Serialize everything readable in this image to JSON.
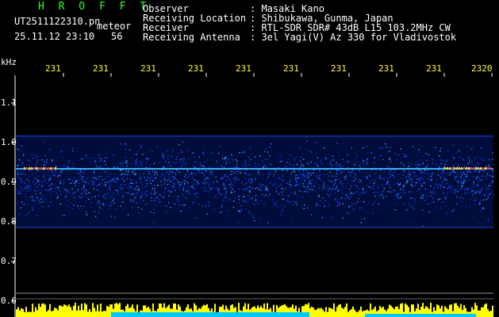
{
  "header": {
    "app_title": "H R O F F T",
    "filename": "UT2511122310.pn",
    "filename_suffix": "meteor",
    "datetime": "25.11.12 23:10",
    "seconds": "56",
    "info_labels": [
      "Observer",
      "Receiving Location",
      "Receiver",
      "Receiving Antenna"
    ],
    "info_values": [
      ": Masaki Kano",
      ": Shibukawa, Gunma, Japan",
      ": RTL-SDR SDR# 43dB L15 103.2MHz CW",
      ": 3el Yagi(V) Az 330 for Vladivostok"
    ]
  },
  "axis": {
    "unit_label": "kHz",
    "y_ticks": [
      "1.1",
      "1.0",
      "0.9",
      "0.8",
      "0.7",
      "0.6"
    ],
    "time_labels": [
      "231",
      "231",
      "231",
      "231",
      "231",
      "231",
      "231",
      "231",
      "231",
      "2320"
    ]
  },
  "colors": {
    "title_green": "#30ff30",
    "label_yellow": "#ffff40",
    "signal_red": "#ff3030",
    "activity_bar": "#ffff00",
    "baseline_cyan": "#00c8ff"
  }
}
